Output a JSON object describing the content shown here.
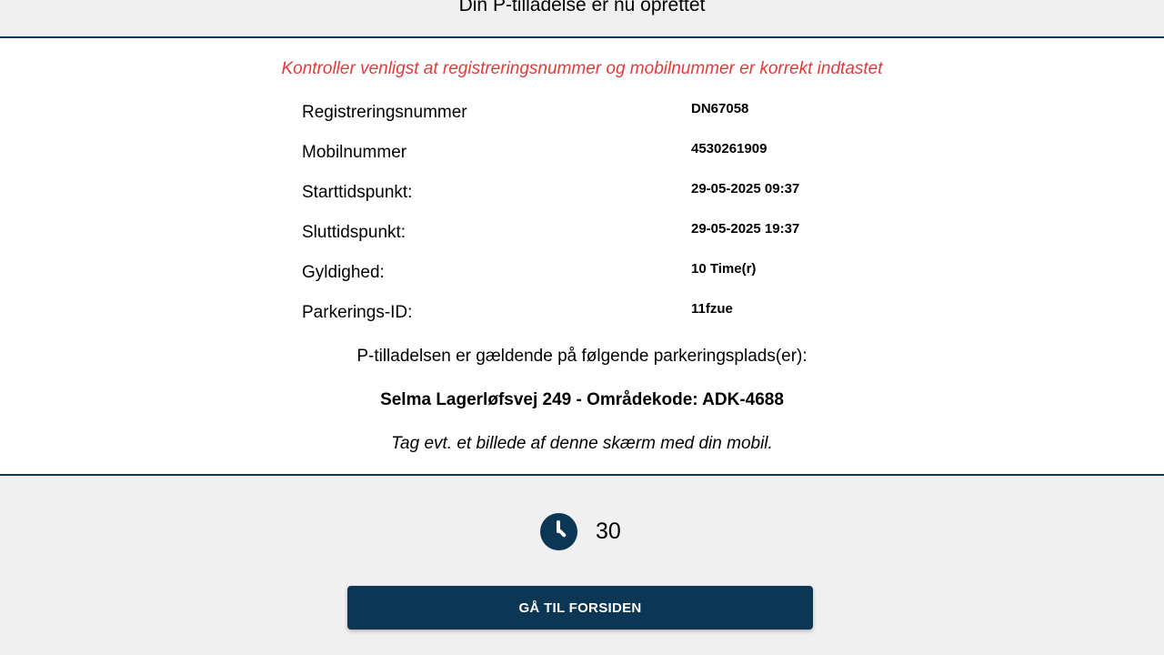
{
  "header": {
    "title": "Din P-tilladelse er nu oprettet"
  },
  "warning": "Kontroller venligst at registreringsnummer og mobilnummer er korrekt indtastet",
  "details": [
    {
      "label": "Registreringsnummer",
      "value": "DN67058"
    },
    {
      "label": "Mobilnummer",
      "value": "4530261909"
    },
    {
      "label": "Starttidspunkt:",
      "value": "29-05-2025 09:37"
    },
    {
      "label": "Sluttidspunkt:",
      "value": "29-05-2025 19:37"
    },
    {
      "label": "Gyldighed:",
      "value": "10 Time(r)"
    },
    {
      "label": "Parkerings-ID:",
      "value": "11fzue"
    }
  ],
  "valid_text": "P-tilladelsen er gældende på følgende parkeringsplads(er):",
  "location": "Selma Lagerløfsvej 249 - Områdekode: ADK-4688",
  "photo_hint": "Tag evt. et billede af denne skærm med din mobil.",
  "countdown": {
    "icon": "clock-icon",
    "value": "30"
  },
  "home_button": {
    "label": "GÅ TIL FORSIDEN"
  },
  "colors": {
    "primary": "#0b3654",
    "warning": "#e5393b",
    "background": "#f0f0f0"
  }
}
